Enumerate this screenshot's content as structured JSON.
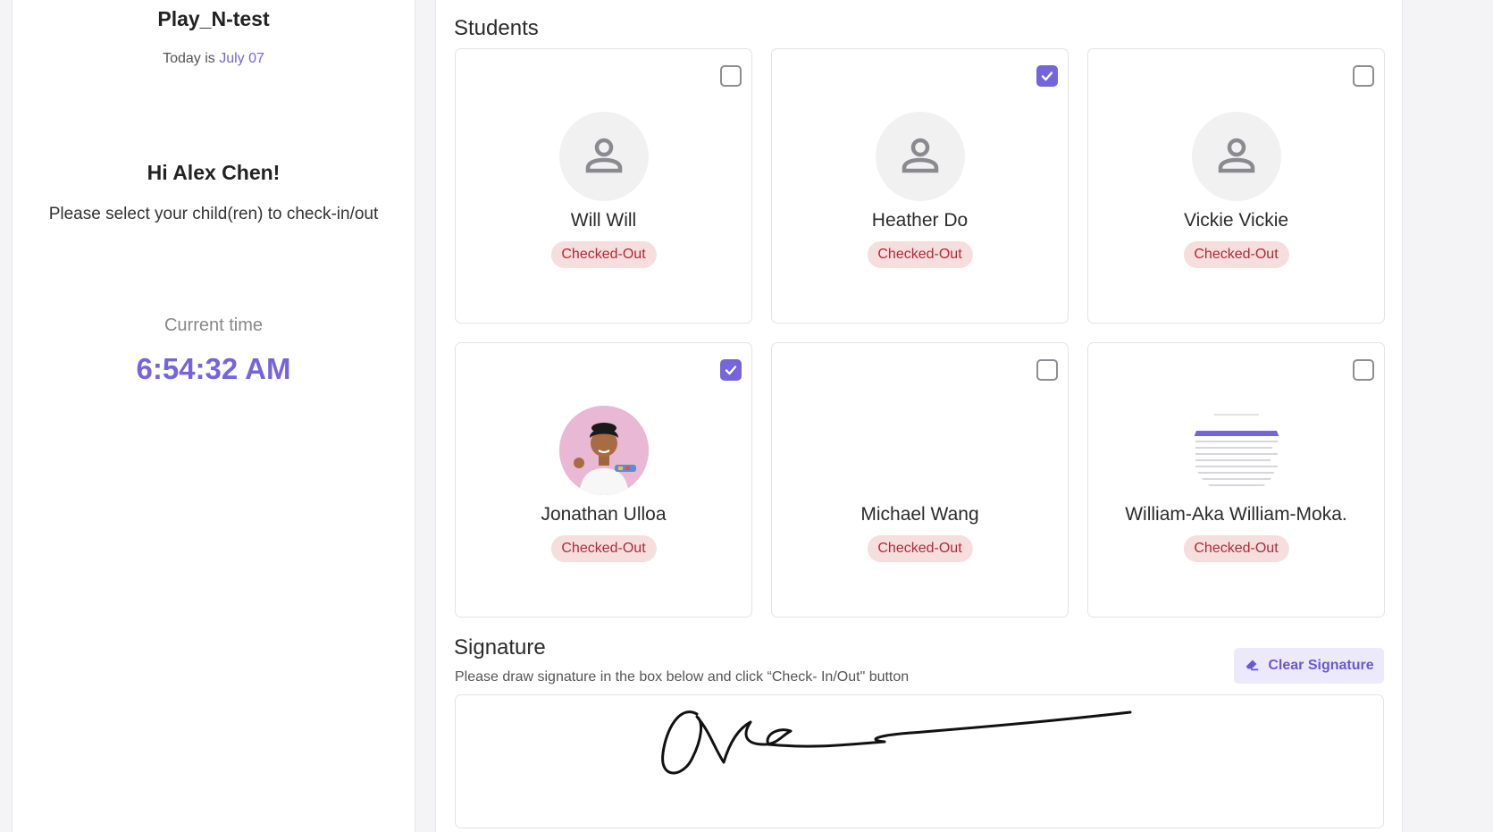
{
  "left": {
    "school_name": "Play_N-test",
    "today_prefix": "Today is",
    "today_date": "July 07",
    "greeting": "Hi Alex Chen!",
    "instruction": "Please select your child(ren) to check-in/out",
    "time_label": "Current time",
    "time_value": "6:54:32 AM"
  },
  "students": {
    "title": "Students",
    "items": [
      {
        "name": "Will Will",
        "status": "Checked-Out",
        "checked": false,
        "avatar": "person-placeholder-icon"
      },
      {
        "name": "Heather Do",
        "status": "Checked-Out",
        "checked": true,
        "avatar": "person-placeholder-icon"
      },
      {
        "name": "Vickie Vickie",
        "status": "Checked-Out",
        "checked": false,
        "avatar": "person-placeholder-icon"
      },
      {
        "name": "Jonathan Ulloa",
        "status": "Checked-Out",
        "checked": true,
        "avatar": "child-photo"
      },
      {
        "name": "Michael Wang",
        "status": "Checked-Out",
        "checked": false,
        "avatar": "none"
      },
      {
        "name": "William-Aka William-Moka.",
        "status": "Checked-Out",
        "checked": false,
        "avatar": "screenshot-thumbnail"
      }
    ]
  },
  "signature": {
    "title": "Signature",
    "hint": "Please draw signature in the box below and click “Check- In/Out\" button",
    "clear_label": "Clear Signature"
  },
  "colors": {
    "accent": "#7565dd",
    "status_bg": "#f6dede",
    "status_text": "#b02a37"
  }
}
